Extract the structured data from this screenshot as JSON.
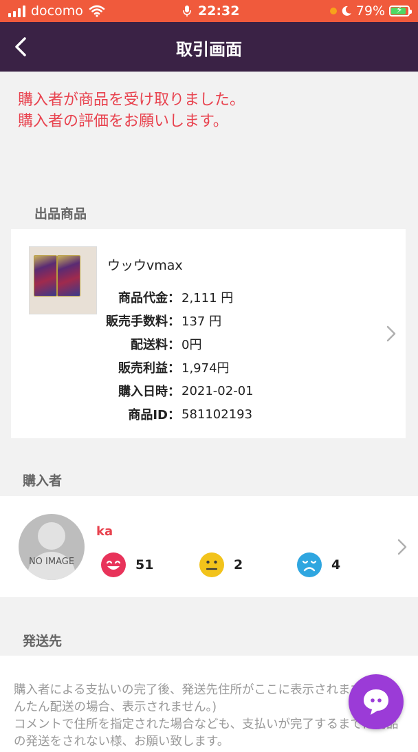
{
  "status_bar": {
    "carrier": "docomo",
    "time": "22:32",
    "battery": "79%"
  },
  "nav": {
    "title": "取引画面"
  },
  "notice": {
    "line1": "購入者が商品を受け取りました。",
    "line2": "購入者の評価をお願いします。"
  },
  "product_section": {
    "label": "出品商品",
    "name": "ウッウvmax",
    "rows": [
      {
        "key": "商品代金：",
        "value": "2,111 円"
      },
      {
        "key": "販売手数料：",
        "value": "137 円"
      },
      {
        "key": "配送料：",
        "value": "0円"
      },
      {
        "key": "販売利益：",
        "value": "1,974円"
      },
      {
        "key": "購入日時：",
        "value": "2021-02-01"
      },
      {
        "key": "商品ID：",
        "value": "581102193"
      }
    ]
  },
  "buyer_section": {
    "label": "購入者",
    "avatar_text": "NO IMAGE",
    "name": "ka",
    "ratings": {
      "good": "51",
      "normal": "2",
      "bad": "4"
    }
  },
  "shipping_section": {
    "label": "発送先",
    "line1": "購入者による支払いの完了後、発送先住所がここに表示されます。(かんたん配送の場合、表示されません。)",
    "line2": "コメントで住所を指定された場合なども、支払いが完了するまでは商品の発送をされない様、お願い致します。"
  },
  "colors": {
    "status_bar": "#f05a3c",
    "nav_bar": "#3a2245",
    "notice_text": "#e8424e",
    "fab": "#9b3bd7",
    "good": "#e8335a",
    "normal": "#f2c31b",
    "bad": "#2fa6e0"
  },
  "icons": {
    "back": "chevron-left-icon",
    "chevron": "chevron-right-icon",
    "chat": "chat-bubble-icon",
    "wifi": "wifi-icon",
    "mic": "mic-icon",
    "moon": "moon-icon"
  }
}
